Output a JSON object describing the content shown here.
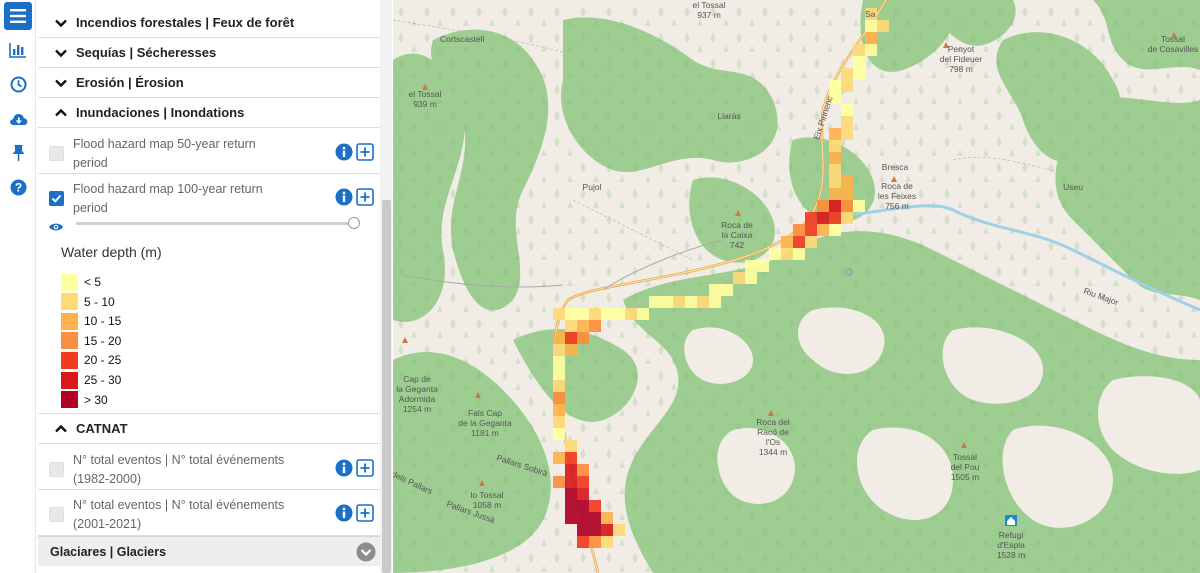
{
  "sidebar_categories": {
    "wildfires": "Incendios forestales | Feux de forêt",
    "droughts": "Sequías | Sécheresses",
    "erosion": "Erosión | Érosion",
    "floods": "Inundaciones | Inondations",
    "catnat": "CATNAT",
    "glaciers": "Glaciares | Glaciers"
  },
  "flood_layers": [
    {
      "line1": "Flood hazard map 50-year return",
      "line2": "period",
      "checked": false
    },
    {
      "line1": "Flood hazard map 100-year return",
      "line2": "period",
      "checked": true
    }
  ],
  "opacity_slider": {
    "value": 1.0
  },
  "legend": {
    "title": "Water depth (m)",
    "items": [
      {
        "label": "< 5",
        "color": "#ffffa0"
      },
      {
        "label": "5 - 10",
        "color": "#fed976"
      },
      {
        "label": "10 - 15",
        "color": "#feb24c"
      },
      {
        "label": "15 - 20",
        "color": "#fd8d3c"
      },
      {
        "label": "20 - 25",
        "color": "#f03b20"
      },
      {
        "label": "25 - 30",
        "color": "#d7191c"
      },
      {
        "label": "> 30",
        "color": "#b00026"
      }
    ]
  },
  "catnat_layers": [
    {
      "line1": "N° total eventos | N° total événements",
      "line2": "(1982-2000)",
      "checked": false
    },
    {
      "line1": "N° total eventos | N° total événements",
      "line2": "(2001-2021)",
      "checked": false
    }
  ],
  "colors": {
    "accent": "#1b6fc7",
    "forest": "#95cc8a",
    "terrain": "#f1ede6",
    "river": "#9fd0e6"
  },
  "icons": [
    "menu-icon",
    "chart-icon",
    "clock-icon",
    "cloud-download-icon",
    "pin-icon",
    "help-icon",
    "info-icon",
    "add-icon",
    "eye-icon",
    "chevron-down-icon",
    "chevron-up-icon"
  ],
  "map_labels": {
    "el_tossal_937": "el Tossal",
    "el_tossal_937_elev": "937 m",
    "sa": "Sa",
    "cortscastell": "Cortscastell",
    "penyot": "Penyot",
    "penyot2": "del Fideuer",
    "penyot_elev": "798 m",
    "tossal_cosa": "Tossal",
    "tossal_cosa2": "de Cosavilles",
    "el_tossal_939": "el Tossal",
    "el_tossal_939_elev": "939 m",
    "llaras": "Llaràs",
    "eix": "Eix Pirinenc",
    "bresca": "Bresca",
    "roca_feixes": "Roca de",
    "roca_feixes2": "les Feixes",
    "roca_feixes_elev": "756 m",
    "useu": "Useu",
    "pujol": "Pujol",
    "roca_caixa": "Roca de",
    "roca_caixa2": "la Caixa",
    "roca_caixa_elev": "742",
    "riu_majou": "Riu Major",
    "cap_geganta": "Cap de",
    "cap_geganta2": "la Geganta",
    "cap_geganta3": "Adormida",
    "cap_geganta_elev": "1254 m",
    "fals_cap": "Fals Cap",
    "fals_cap2": "de la Geganta",
    "fals_cap_elev": "1181 m",
    "roca_raco": "Roca del",
    "roca_raco2": "Racó de",
    "roca_raco3": "l'Os",
    "roca_raco_elev": "1344 m",
    "tossal_pou": "Tossal",
    "tossal_pou2": "del Pou",
    "tossal_pou_elev": "1505 m",
    "lo_tossal": "lo Tossal",
    "lo_tossal_elev": "1058 m",
    "pallars": "Pallars Sobirà",
    "pallars2": "Pallars Jussà",
    "refugi": "Refugi",
    "refugi2": "d'Espla",
    "refugi_elev": "1528 m",
    "hex_pallars": "dels Pallars"
  }
}
